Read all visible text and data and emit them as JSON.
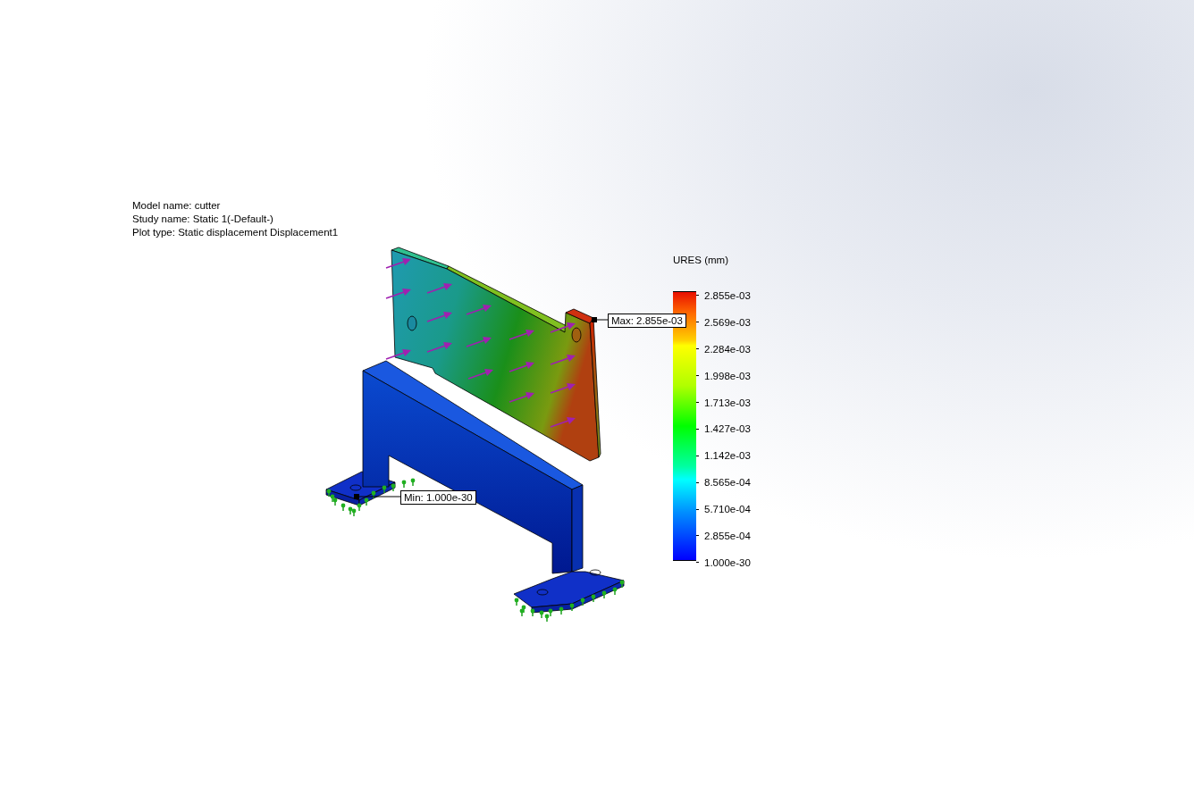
{
  "info": [
    "Model name: cutter",
    "Study name: Static 1(-Default-)",
    "Plot type: Static displacement Displacement1"
  ],
  "legend": {
    "title": "URES (mm)",
    "labels": [
      "2.855e-03",
      "2.569e-03",
      "2.284e-03",
      "1.998e-03",
      "1.713e-03",
      "1.427e-03",
      "1.142e-03",
      "8.565e-04",
      "5.710e-04",
      "2.855e-04",
      "1.000e-30"
    ]
  },
  "max_label": "Max: 2.855e-03",
  "min_label": "Min: 1.000e-30"
}
